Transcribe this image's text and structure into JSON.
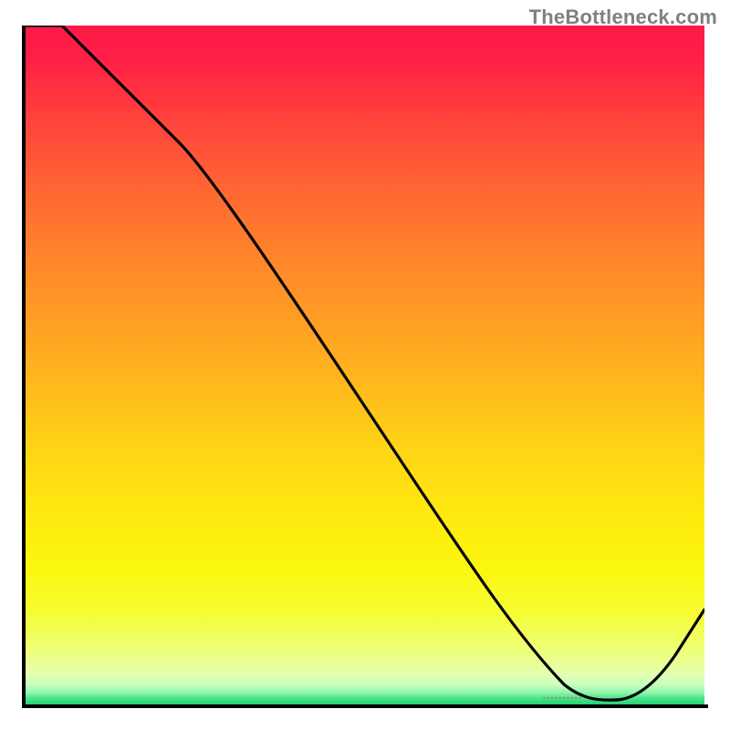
{
  "watermark": "TheBottleneck.com",
  "marker_text": "··········",
  "colors": {
    "gradient_top": "#ff1948",
    "gradient_mid": "#ffd316",
    "gradient_bottom": "#1fd472",
    "axis": "#000000",
    "curve": "#000000",
    "marker": "#d2403d",
    "watermark": "#808080"
  },
  "chart_data": {
    "type": "line",
    "title": "",
    "xlabel": "",
    "ylabel": "",
    "xlim": [
      0,
      100
    ],
    "ylim": [
      0,
      100
    ],
    "x": [
      0,
      5,
      22,
      50,
      70,
      78,
      86,
      100
    ],
    "values": [
      100,
      100,
      84,
      42,
      12,
      2,
      2,
      22
    ],
    "annotations": [
      {
        "x": 82,
        "y": 1,
        "text": "··········"
      }
    ],
    "notes": "Single black curve over a vertical red→yellow→green gradient. Curve descends from top-left, flattens near x≈78–86 at bottom (green band), then rises toward right edge. Dotted red marker sits at the flat valley."
  }
}
